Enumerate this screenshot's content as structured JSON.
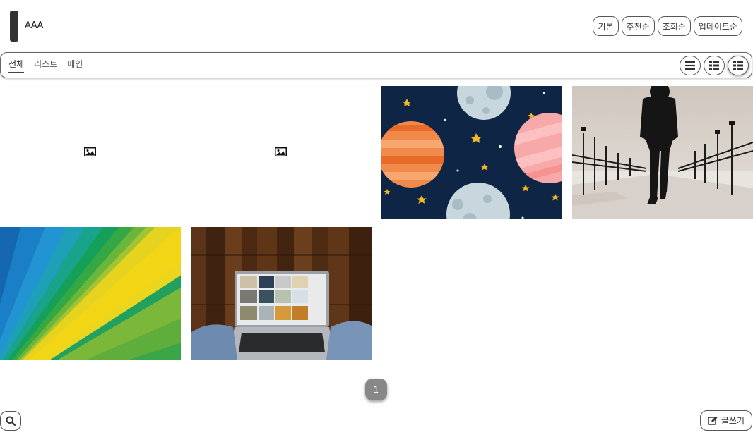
{
  "header": {
    "board_title": "AAA",
    "sort_buttons": [
      "기본",
      "추천순",
      "조회순",
      "업데이트순"
    ]
  },
  "tabs": [
    {
      "label": "전체",
      "active": true
    },
    {
      "label": "리스트",
      "active": false
    },
    {
      "label": "메인",
      "active": false
    }
  ],
  "view_buttons": [
    {
      "icon": "list-icon",
      "active": false
    },
    {
      "icon": "webzine-icon",
      "active": false
    },
    {
      "icon": "gallery-grid-icon",
      "active": true
    }
  ],
  "gallery": [
    {
      "image": "broken-image-icon"
    },
    {
      "image": "broken-image-icon"
    },
    {
      "image": "planets-illustration"
    },
    {
      "image": "person-walking-photo"
    },
    {
      "image": "rainbow-gradient-photo"
    },
    {
      "image": "laptop-on-desk-photo"
    }
  ],
  "pagination": {
    "current_page": "1"
  },
  "footer": {
    "search_icon": "search-icon",
    "write_icon": "edit-icon",
    "write_label": "글쓰기"
  }
}
